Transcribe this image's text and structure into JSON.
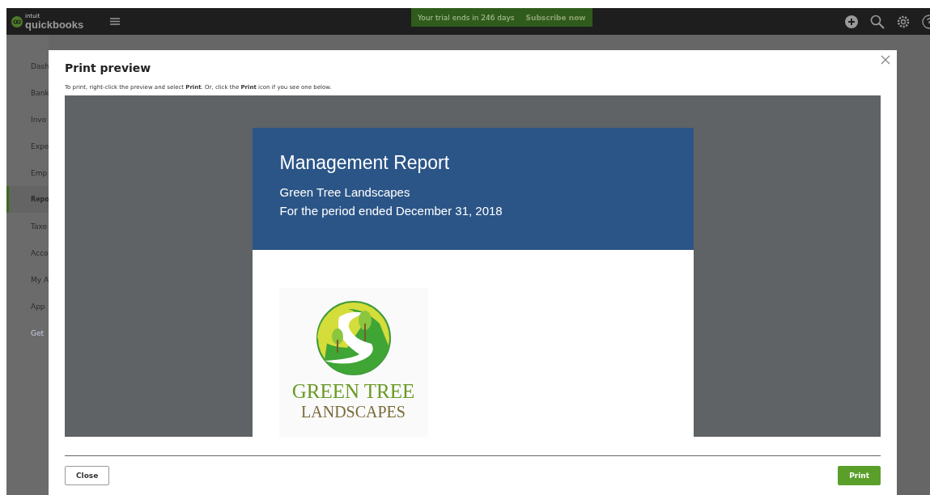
{
  "topbar": {
    "brand_small": "intuit",
    "brand": "quickbooks",
    "trial": "Your trial ends in 246 days",
    "subscribe": "Subscribe now"
  },
  "sidebar": {
    "items": [
      {
        "label": "Dash",
        "selected": false,
        "kind": "item"
      },
      {
        "label": "Bank",
        "selected": false,
        "kind": "item"
      },
      {
        "label": "Invo",
        "selected": false,
        "kind": "item"
      },
      {
        "label": "Expe",
        "selected": false,
        "kind": "item"
      },
      {
        "label": "Emp",
        "selected": false,
        "kind": "item"
      },
      {
        "label": "Repo",
        "selected": true,
        "kind": "item"
      },
      {
        "label": "Taxe",
        "selected": false,
        "kind": "item"
      },
      {
        "label": "Acco",
        "selected": false,
        "kind": "item"
      },
      {
        "label": "My A",
        "selected": false,
        "kind": "item"
      },
      {
        "label": "App",
        "selected": false,
        "kind": "item"
      },
      {
        "label": "Get",
        "selected": false,
        "kind": "link"
      }
    ]
  },
  "dialog": {
    "title": "Print preview",
    "instructions": "To print, right-click the preview and select **Print**. Or, click the **Print** icon if you see one below.",
    "report": {
      "title": "Management Report",
      "company": "Green Tree Landscapes",
      "period": "For the period ended December 31, 2018",
      "logo_line_1": "GREEN TREE",
      "logo_line_2": "LANDSCAPES"
    },
    "buttons": [
      {
        "label": "Close",
        "kind": "secondary"
      },
      {
        "label": "Print",
        "kind": "primary"
      }
    ]
  }
}
